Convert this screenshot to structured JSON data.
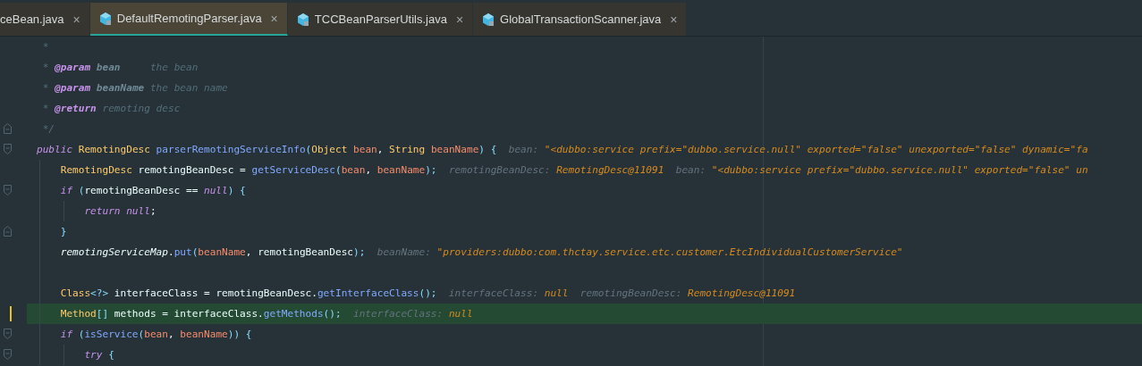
{
  "tabs": [
    {
      "label": "ceBean.java",
      "close": "×",
      "selected": false,
      "icon": false
    },
    {
      "label": "DefaultRemotingParser.java",
      "close": "×",
      "selected": true,
      "icon": true
    },
    {
      "label": "TCCBeanParserUtils.java",
      "close": "×",
      "selected": false,
      "icon": true
    },
    {
      "label": "GlobalTransactionScanner.java",
      "close": "×",
      "selected": false,
      "icon": true
    }
  ],
  "code": {
    "lines": [
      {
        "kind": "plain",
        "current": false,
        "tokens": [
          {
            "kind": "comment",
            "text": " *"
          }
        ]
      },
      {
        "kind": "plain",
        "current": false,
        "tokens": [
          {
            "kind": "comment",
            "text": " * "
          },
          {
            "kind": "doctag",
            "text": "@param "
          },
          {
            "kind": "docparam",
            "text": "bean"
          },
          {
            "kind": "comment",
            "text": "     the bean"
          }
        ]
      },
      {
        "kind": "plain",
        "current": false,
        "tokens": [
          {
            "kind": "comment",
            "text": " * "
          },
          {
            "kind": "doctag",
            "text": "@param "
          },
          {
            "kind": "docparam",
            "text": "beanName"
          },
          {
            "kind": "comment",
            "text": " the bean name"
          }
        ]
      },
      {
        "kind": "plain",
        "current": false,
        "tokens": [
          {
            "kind": "comment",
            "text": " * "
          },
          {
            "kind": "doctag",
            "text": "@return"
          },
          {
            "kind": "comment",
            "text": " remoting desc"
          }
        ]
      },
      {
        "kind": "closer",
        "current": false,
        "tokens": [
          {
            "kind": "comment",
            "text": " */"
          }
        ]
      },
      {
        "kind": "opener",
        "current": false,
        "tokens": [
          {
            "kind": "keyword",
            "text": "public "
          },
          {
            "kind": "type",
            "text": "RemotingDesc "
          },
          {
            "kind": "method",
            "text": "parserRemotingServiceInfo"
          },
          {
            "kind": "punct",
            "text": "("
          },
          {
            "kind": "type",
            "text": "Object "
          },
          {
            "kind": "param",
            "text": "bean"
          },
          {
            "kind": "plain",
            "text": ", "
          },
          {
            "kind": "type",
            "text": "String "
          },
          {
            "kind": "param",
            "text": "beanName"
          },
          {
            "kind": "punct",
            "text": ") {"
          },
          {
            "kind": "hint-name",
            "text": "  bean: "
          },
          {
            "kind": "hint-value",
            "text": "\"<dubbo:service prefix=\"dubbo.service.null\" exported=\"false\" unexported=\"false\" dynamic=\"fa"
          }
        ],
        "children": [
          {
            "kind": "plain",
            "current": false,
            "tokens": [
              {
                "kind": "type",
                "text": "RemotingDesc"
              },
              {
                "kind": "plain",
                "text": " remotingBeanDesc = "
              },
              {
                "kind": "method",
                "text": "getServiceDesc"
              },
              {
                "kind": "punct",
                "text": "("
              },
              {
                "kind": "param",
                "text": "bean"
              },
              {
                "kind": "plain",
                "text": ", "
              },
              {
                "kind": "param",
                "text": "beanName"
              },
              {
                "kind": "punct",
                "text": ");"
              },
              {
                "kind": "hint-name",
                "text": "  remotingBeanDesc: "
              },
              {
                "kind": "hint-value",
                "text": "RemotingDesc@11091"
              },
              {
                "kind": "hint-name",
                "text": "  bean: "
              },
              {
                "kind": "hint-value",
                "text": "\"<dubbo:service prefix=\"dubbo.service.null\" exported=\"false\" un"
              }
            ]
          },
          {
            "kind": "opener",
            "current": false,
            "tokens": [
              {
                "kind": "keyword",
                "text": "if"
              },
              {
                "kind": "punct",
                "text": " ("
              },
              {
                "kind": "plain",
                "text": "remotingBeanDesc == "
              },
              {
                "kind": "keyword",
                "text": "null"
              },
              {
                "kind": "punct",
                "text": ") {"
              }
            ],
            "children": [
              {
                "kind": "plain",
                "current": false,
                "tokens": [
                  {
                    "kind": "keyword",
                    "text": "return null"
                  },
                  {
                    "kind": "plain",
                    "text": ";"
                  }
                ]
              }
            ]
          },
          {
            "kind": "closer",
            "current": false,
            "tokens": [
              {
                "kind": "punct",
                "text": "}"
              }
            ]
          },
          {
            "kind": "plain",
            "current": false,
            "tokens": [
              {
                "kind": "field",
                "text": "remotingServiceMap"
              },
              {
                "kind": "plain",
                "text": "."
              },
              {
                "kind": "method",
                "text": "put"
              },
              {
                "kind": "punct",
                "text": "("
              },
              {
                "kind": "param",
                "text": "beanName"
              },
              {
                "kind": "plain",
                "text": ", remotingBeanDesc"
              },
              {
                "kind": "punct",
                "text": ");"
              },
              {
                "kind": "hint-name",
                "text": "  beanName: "
              },
              {
                "kind": "hint-value",
                "text": "\"providers:dubbo:com.thctay.service.etc.customer.EtcIndividualCustomerService\""
              }
            ]
          },
          {
            "kind": "plain",
            "current": false
          },
          {
            "kind": "plain",
            "current": false,
            "tokens": [
              {
                "kind": "type",
                "text": "Class"
              },
              {
                "kind": "punct",
                "text": "<?>"
              },
              {
                "kind": "plain",
                "text": " interfaceClass = remotingBeanDesc."
              },
              {
                "kind": "method",
                "text": "getInterfaceClass"
              },
              {
                "kind": "punct",
                "text": "();"
              },
              {
                "kind": "hint-name",
                "text": "  interfaceClass: "
              },
              {
                "kind": "hint-value",
                "text": "null"
              },
              {
                "kind": "hint-name",
                "text": "  remotingBeanDesc: "
              },
              {
                "kind": "hint-value",
                "text": "RemotingDesc@11091"
              }
            ]
          },
          {
            "kind": "plain",
            "current": true,
            "tokens": [
              {
                "kind": "type",
                "text": "Method"
              },
              {
                "kind": "punct",
                "text": "[]"
              },
              {
                "kind": "plain",
                "text": " methods = interfaceClass."
              },
              {
                "kind": "method",
                "text": "getMethods"
              },
              {
                "kind": "punct",
                "text": "();"
              },
              {
                "kind": "hint-name",
                "text": "  interfaceClass: "
              },
              {
                "kind": "hint-value",
                "text": "null"
              }
            ]
          },
          {
            "kind": "opener",
            "current": false,
            "tokens": [
              {
                "kind": "keyword",
                "text": "if"
              },
              {
                "kind": "punct",
                "text": " ("
              },
              {
                "kind": "method",
                "text": "isService"
              },
              {
                "kind": "punct",
                "text": "("
              },
              {
                "kind": "param",
                "text": "bean"
              },
              {
                "kind": "plain",
                "text": ", "
              },
              {
                "kind": "param",
                "text": "beanName"
              },
              {
                "kind": "punct",
                "text": ")) {"
              }
            ],
            "children": [
              {
                "kind": "opener",
                "current": false,
                "tokens": [
                  {
                    "kind": "keyword",
                    "text": "try"
                  },
                  {
                    "kind": "punct",
                    "text": " {"
                  }
                ]
              }
            ]
          }
        ]
      }
    ]
  }
}
